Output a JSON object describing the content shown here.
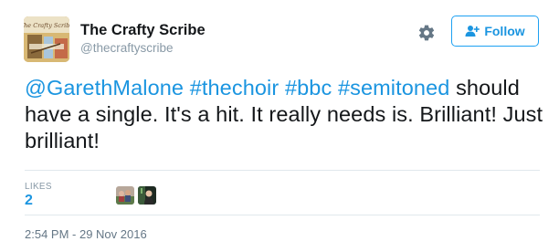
{
  "author": {
    "name": "The Crafty Scribe",
    "handle": "@thecraftyscribe",
    "avatar_icon": "crafty-scribe-logo",
    "avatar_text": "The Crafty Scribe"
  },
  "actions": {
    "settings_icon": "gear-icon",
    "follow_label": "Follow",
    "follow_icon": "add-user-icon"
  },
  "tweet": {
    "segments": [
      {
        "text": "@GarethMalone",
        "type": "mention"
      },
      {
        "text": " ",
        "type": "text"
      },
      {
        "text": "#thechoir",
        "type": "hashtag"
      },
      {
        "text": " ",
        "type": "text"
      },
      {
        "text": "#bbc",
        "type": "hashtag"
      },
      {
        "text": " ",
        "type": "text"
      },
      {
        "text": "#semitoned",
        "type": "hashtag"
      },
      {
        "text": " should have a single. It's a hit. It really needs is. Brilliant! Just brilliant!",
        "type": "text"
      }
    ]
  },
  "stats": {
    "likes_label": "LIKES",
    "likes_count": "2"
  },
  "likers": [
    "liker-avatar-1",
    "liker-avatar-2"
  ],
  "timestamp": "2:54 PM - 29 Nov 2016",
  "colors": {
    "link": "#1b95e0",
    "follow_border": "#1da1f2",
    "muted": "#8899a6",
    "divider": "#e1e8ed"
  }
}
